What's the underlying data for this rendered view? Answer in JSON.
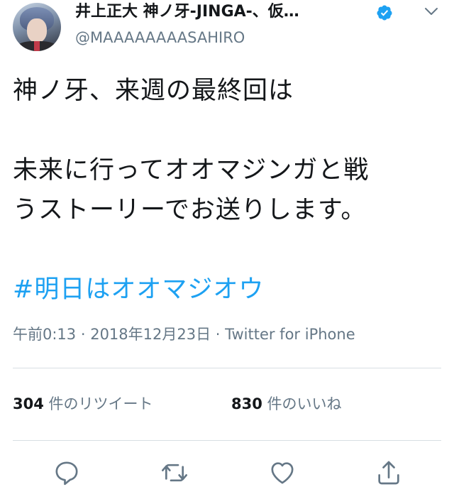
{
  "author": {
    "display_name": "井上正大 神ノ牙-JINGA-、仮…",
    "handle": "@MAAAAAAAASAHIRO",
    "verified_icon": "verified-badge-icon",
    "menu_icon": "chevron-down-icon"
  },
  "tweet": {
    "lines": [
      "神ノ牙、来週の最終回は",
      "",
      "未来に行ってオオマジンガと戦",
      "うストーリーでお送りします。",
      ""
    ],
    "hashtag": "#明日はオオマジオウ"
  },
  "meta": {
    "time": "午前0:13",
    "separator1": " · ",
    "date": "2018年12月23日",
    "separator2": " · ",
    "source": "Twitter for iPhone"
  },
  "stats": {
    "retweets_count": "304",
    "retweets_label": " 件のリツイート",
    "likes_count": "830",
    "likes_label": " 件のいいね"
  },
  "actions": {
    "reply_icon": "reply-icon",
    "retweet_icon": "retweet-icon",
    "like_icon": "heart-icon",
    "share_icon": "share-icon"
  },
  "colors": {
    "accent": "#1da1f2",
    "secondary_text": "#657786",
    "primary_text": "#14171a",
    "divider": "#d8dee3"
  }
}
